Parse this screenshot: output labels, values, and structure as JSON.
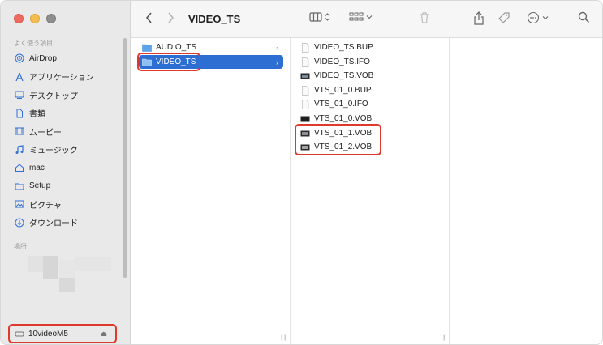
{
  "window": {
    "title": "VIDEO_TS"
  },
  "sidebar": {
    "favorites_heading": "よく使う項目",
    "items": [
      {
        "label": "AirDrop",
        "icon": "airdrop-icon"
      },
      {
        "label": "アプリケーション",
        "icon": "applications-icon"
      },
      {
        "label": "デスクトップ",
        "icon": "desktop-icon"
      },
      {
        "label": "書類",
        "icon": "document-icon"
      },
      {
        "label": "ムービー",
        "icon": "movie-icon"
      },
      {
        "label": "ミュージック",
        "icon": "music-icon"
      },
      {
        "label": "mac",
        "icon": "home-icon"
      },
      {
        "label": "Setup",
        "icon": "folder-icon"
      },
      {
        "label": "ピクチャ",
        "icon": "pictures-icon"
      },
      {
        "label": "ダウンロード",
        "icon": "download-icon"
      }
    ],
    "locations_heading": "場所",
    "device": {
      "label": "10videoM5",
      "icon": "drive-icon"
    }
  },
  "columns": {
    "col1": [
      {
        "label": "AUDIO_TS",
        "icon": "folder-icon",
        "selected": false
      },
      {
        "label": "VIDEO_TS",
        "icon": "folder-icon",
        "selected": true
      }
    ],
    "col2": [
      {
        "label": "VIDEO_TS.BUP",
        "icon": "file-icon"
      },
      {
        "label": "VIDEO_TS.IFO",
        "icon": "file-icon"
      },
      {
        "label": "VIDEO_TS.VOB",
        "icon": "video-file-icon"
      },
      {
        "label": "VTS_01_0.BUP",
        "icon": "file-icon"
      },
      {
        "label": "VTS_01_0.IFO",
        "icon": "file-icon"
      },
      {
        "label": "VTS_01_0.VOB",
        "icon": "video-file-icon"
      },
      {
        "label": "VTS_01_1.VOB",
        "icon": "video-file-icon"
      },
      {
        "label": "VTS_01_2.VOB",
        "icon": "video-file-icon"
      }
    ]
  },
  "colors": {
    "accent": "#2d6ed3",
    "highlight": "#e0392b"
  }
}
